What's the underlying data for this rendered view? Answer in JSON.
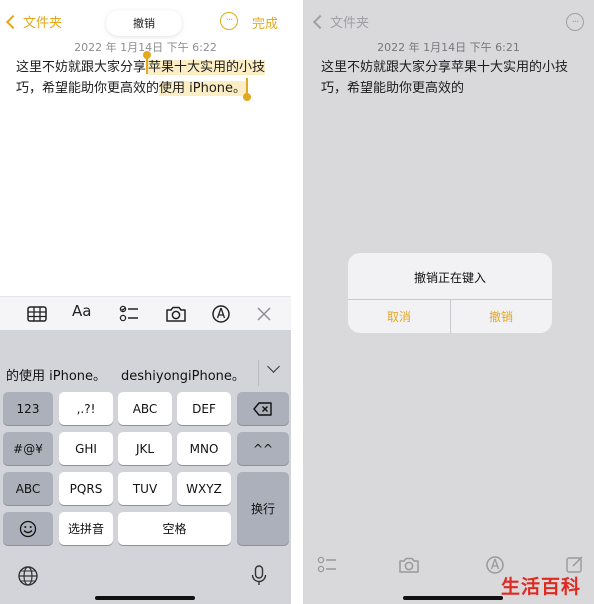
{
  "left": {
    "nav": {
      "back_label": "文件夹",
      "undo_label": "撤销",
      "more_glyph": "···",
      "done_label": "完成"
    },
    "date": "2022 年 1月14日 下午 6:22",
    "note": {
      "line1_a": "这里不妨就跟大家分享",
      "line1_b": "苹果十大实用的小技",
      "line2_a": "巧，希望能助你更高效的",
      "line2_b": "使用 iPhone。"
    },
    "toolbar": [
      "table-icon",
      "text-format-icon",
      "checklist-icon",
      "camera-icon",
      "markup-icon",
      "close-icon"
    ],
    "toolbar_text": "Aa",
    "candidates": [
      "的使用 iPhone。",
      "deshiyongiPhone。"
    ],
    "keys": {
      "num": "123",
      "punct": ",.?!",
      "abc": "ABC",
      "def": "DEF",
      "sym": "#@¥",
      "ghi": "GHI",
      "jkl": "JKL",
      "mno": "MNO",
      "face": "^^",
      "abc2": "ABC",
      "pqrs": "PQRS",
      "tuv": "TUV",
      "wxyz": "WXYZ",
      "return": "换行",
      "pinyin": "选拼音",
      "space": "空格"
    }
  },
  "right": {
    "nav": {
      "back_label": "文件夹",
      "more_glyph": "···"
    },
    "date": "2022 年 1月14日 下午 6:21",
    "note": {
      "line1": "这里不妨就跟大家分享苹果十大实用的小技",
      "line2": "巧，希望能助你更高效的"
    },
    "alert": {
      "title": "撤销正在键入",
      "cancel": "取消",
      "confirm": "撤销"
    }
  },
  "watermark": "生活百科",
  "colors": {
    "accent": "#e3a81e",
    "highlight": "#fbeec4",
    "keyboard_bg": "#d2d4d9",
    "dim_bg": "#d9d9dc",
    "watermark": "#e02a20"
  }
}
